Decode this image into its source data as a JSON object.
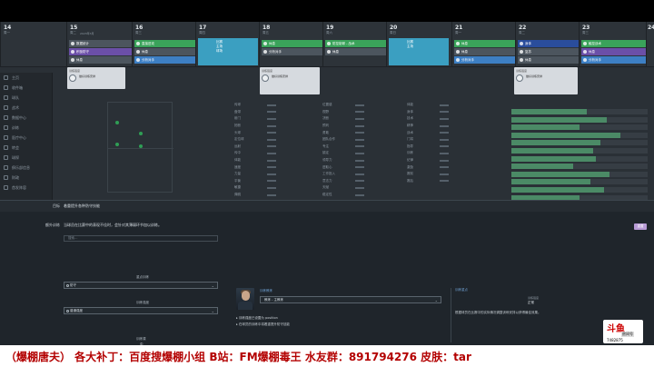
{
  "calendar": {
    "days": [
      {
        "num": "14",
        "name": "周一"
      },
      {
        "num": "15",
        "name": "周二"
      },
      {
        "num": "16",
        "name": "周三"
      },
      {
        "num": "17",
        "name": "周四"
      },
      {
        "num": "18",
        "name": "周五"
      },
      {
        "num": "19",
        "name": "周六"
      },
      {
        "num": "20",
        "name": "周日"
      },
      {
        "num": "21",
        "name": "周一"
      },
      {
        "num": "22",
        "name": "周二"
      },
      {
        "num": "23",
        "name": "周三"
      },
      {
        "num": "24",
        "name": "周四"
      }
    ],
    "date_small": "2023年3月",
    "events": {
      "e1": "数据统计",
      "e2": "积极防守",
      "e3": "休息",
      "e4": "直接进攻",
      "e5": "休息",
      "e6": "分析对手",
      "e7": "比赛",
      "e8": "主场",
      "e9": "球场",
      "e10": "休息",
      "e11": "分析对手",
      "e12": "防控制球 - 战术",
      "e13": "休息",
      "e14": "比赛",
      "e15": "主场",
      "e16": "休息",
      "e17": "休息",
      "e18": "分析对手",
      "e19": "身体",
      "e20": "复苏",
      "e21": "休息",
      "e22": "触控战术",
      "e23": "休息",
      "e24": "分析对手"
    },
    "cards": {
      "c1_head": "训练强度",
      "c1_body": "做好训练安排",
      "c2_head": "训练强度",
      "c2_body": "做好训练安排",
      "c3_head": "训练强度",
      "c3_body": "做好训练安排"
    }
  },
  "sidebar": {
    "items": [
      "主页",
      "收件箱",
      "球队",
      "战术",
      "数据中心",
      "训练",
      "医疗中心",
      "转会",
      "球探",
      "俱乐部信息",
      "财政",
      "首发阵容"
    ]
  },
  "stats": {
    "left": [
      "传球",
      "盘带",
      "射门",
      "抢断",
      "头球",
      "定位球",
      "远射",
      "传中",
      "体能",
      "速度",
      "力量",
      "平衡",
      "敏捷",
      "弹跳"
    ],
    "mid": [
      "位置感",
      "视野",
      "决断",
      "预判",
      "勇敢",
      "团队合作",
      "专注",
      "镇定",
      "领导力",
      "进取心",
      "工作投入",
      "意志力",
      "天赋",
      "稳定性"
    ],
    "right": [
      "体能",
      "身体",
      "技术",
      "精神",
      "战术",
      "门将",
      "指导",
      "训练",
      "纪律",
      "激励",
      "赛前",
      "赛后"
    ],
    "bar_fills": [
      0.55,
      0.7,
      0.5,
      0.8,
      0.65,
      0.6,
      0.62,
      0.45,
      0.72,
      0.58,
      0.68,
      0.5,
      0.4,
      0.55
    ]
  },
  "bottom": {
    "row1_label": "目标",
    "row1_text": "着重提升各种防守技能",
    "row2_label": "额外训练",
    "row2_text": "当球员在比赛中的表现不佳时，会针对其薄弱环节加以训练。",
    "reset_label": "重置",
    "search_placeholder": "搜索…",
    "focus_label": "重点训练",
    "focus_value": "防守",
    "intensity_label": "训练强度",
    "intensity_value": "普通强度",
    "sessions_label": "训练课",
    "sessions_value": "中",
    "coach_title": "训练教练",
    "coach_select": "教练 - 主教练",
    "coach_note1": "训练强度已设置为 position",
    "coach_note2": "在球员的训练中将着重提升防守技能",
    "detail_title": "训练重点",
    "detail_sub": "训练强度",
    "detail_val": "正常",
    "detail_desc": "根据球员在比赛中的实际情况调整训练安排以获得最佳效果。"
  },
  "banner": {
    "text": "（爆棚唐夫）  各大补丁：百度搜爆棚小组  B站：FM爆棚毒王  水友群：891794276  皮肤：tar"
  },
  "watermark": {
    "logo": "斗鱼",
    "sub": "房间号",
    "room": "7482875"
  }
}
